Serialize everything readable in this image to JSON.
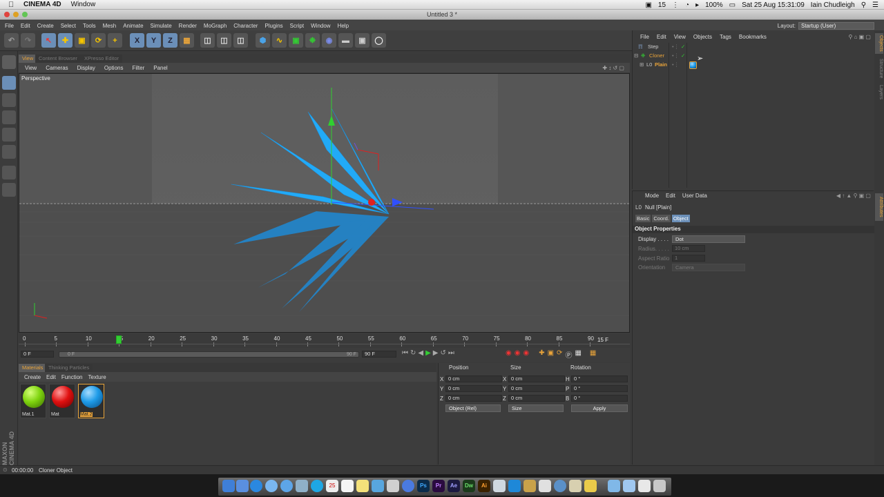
{
  "mac_menubar": {
    "app_name": "CINEMA 4D",
    "menu_item": "Window",
    "status_count": "15",
    "battery": "100%",
    "clock": "Sat 25 Aug  15:31:09",
    "user": "Iain Chudleigh"
  },
  "window": {
    "title": "Untitled 3 *"
  },
  "main_menu": [
    "File",
    "Edit",
    "Create",
    "Select",
    "Tools",
    "Mesh",
    "Animate",
    "Simulate",
    "Render",
    "MoGraph",
    "Character",
    "Plugins",
    "Script",
    "Window",
    "Help"
  ],
  "layout": {
    "label": "Layout:",
    "value": "Startup (User)"
  },
  "viewport": {
    "tabs": [
      "View",
      "Content Browser",
      "XPresso Editor"
    ],
    "menu": [
      "View",
      "Cameras",
      "Display",
      "Options",
      "Filter",
      "Panel"
    ],
    "label": "Perspective"
  },
  "timeline": {
    "ticks": [
      "0",
      "5",
      "10",
      "15",
      "20",
      "25",
      "30",
      "35",
      "40",
      "45",
      "50",
      "55",
      "60",
      "65",
      "70",
      "75",
      "80",
      "85",
      "90"
    ],
    "current_frame_marker": "15",
    "current_frame_display": "15 F",
    "playhead_value": 15,
    "range_max": 90
  },
  "playback": {
    "start_field": "0 F",
    "slider_left": "0 F",
    "slider_right": "90 F",
    "end_field": "90 F"
  },
  "materials": {
    "tabs": [
      "Materials",
      "Thinking Particles"
    ],
    "menu": [
      "Create",
      "Edit",
      "Function",
      "Texture"
    ],
    "items": [
      {
        "label": "Mat.1",
        "color": "#7fd40f"
      },
      {
        "label": "Mat",
        "color": "#e01010"
      },
      {
        "label": "Mat.2",
        "color": "#1e9be8"
      }
    ]
  },
  "coordinates": {
    "headers": [
      "Position",
      "Size",
      "Rotation"
    ],
    "rows": [
      {
        "axis": "X",
        "pos": "0 cm",
        "size_axis": "X",
        "size": "0 cm",
        "rot_axis": "H",
        "rot": "0 °"
      },
      {
        "axis": "Y",
        "pos": "0 cm",
        "size_axis": "Y",
        "size": "0 cm",
        "rot_axis": "P",
        "rot": "0 °"
      },
      {
        "axis": "Z",
        "pos": "0 cm",
        "size_axis": "Z",
        "size": "0 cm",
        "rot_axis": "B",
        "rot": "0 °"
      }
    ],
    "mode": "Object (Rel)",
    "size_mode": "Size",
    "apply": "Apply"
  },
  "object_manager": {
    "menu": [
      "File",
      "Edit",
      "View",
      "Objects",
      "Tags",
      "Bookmarks"
    ],
    "objects": [
      {
        "name": "Step",
        "color": "#e0e0e0"
      },
      {
        "name": "Cloner",
        "color": "#e9a43a"
      },
      {
        "name": "Plain",
        "color": "#e9a43a"
      }
    ]
  },
  "attributes": {
    "menu": [
      "Mode",
      "Edit",
      "User Data"
    ],
    "object_title": "Null [Plain]",
    "tabs": [
      "Basic",
      "Coord.",
      "Object"
    ],
    "section": "Object Properties",
    "fields": [
      {
        "label": "Display . . . .",
        "value": "Dot"
      },
      {
        "label": "Radius. . . . .",
        "value": "10 cm"
      },
      {
        "label": "Aspect Ratio",
        "value": "1"
      },
      {
        "label": "Orientation",
        "value": "Camera"
      }
    ]
  },
  "side_tabs": [
    "Objects",
    "Structure",
    "Layers",
    "Attributes"
  ],
  "status_bar": {
    "time": "00:00:00",
    "message": "Cloner Object"
  },
  "logo": {
    "line1": "MAXON",
    "line2": "CINEMA 4D"
  },
  "colors": {
    "accent": "#e9a43a",
    "object_blue": "#22aaf7",
    "axis_red": "#e02020",
    "axis_green": "#30d030",
    "axis_blue": "#3050ff"
  },
  "dock_icons": [
    "finder-icon",
    "safari-icon",
    "itunes-icon",
    "ical-icon",
    "skype-icon",
    "photoshop-icon",
    "premiere-icon",
    "after-effects-icon",
    "dreamweaver-icon",
    "illustrator-icon",
    "trash-icon"
  ]
}
